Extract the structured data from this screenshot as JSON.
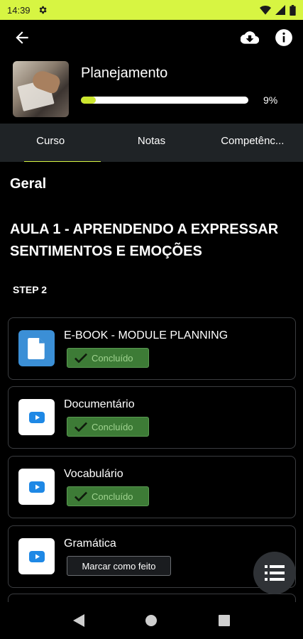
{
  "status_bar": {
    "time": "14:39"
  },
  "header": {
    "course_title": "Planejamento",
    "progress_text": "9%",
    "progress_fraction": 0.09
  },
  "tabs": [
    {
      "label": "Curso",
      "active": true
    },
    {
      "label": "Notas",
      "active": false
    },
    {
      "label": "Competênc...",
      "active": false
    }
  ],
  "content": {
    "section": "Geral",
    "lesson_title": "AULA 1 - APRENDENDO A EXPRESSAR SENTIMENTOS E EMOÇÕES",
    "step_label": "STEP 2",
    "items": [
      {
        "title": "E-BOOK - MODULE PLANNING",
        "icon": "document-icon",
        "status": "Concluído"
      },
      {
        "title": "Documentário",
        "icon": "youtube-icon",
        "status": "Concluído"
      },
      {
        "title": "Vocabulário",
        "icon": "youtube-icon",
        "status": "Concluído"
      },
      {
        "title": "Gramática",
        "icon": "youtube-icon",
        "action": "Marcar como feito"
      }
    ]
  },
  "colors": {
    "accent": "#d7f542",
    "done_badge": "#3d7b36",
    "tab_bar": "#1f2326",
    "ebook_icon_bg": "#3b8fd6",
    "youtube_blue": "#1e88e5"
  }
}
